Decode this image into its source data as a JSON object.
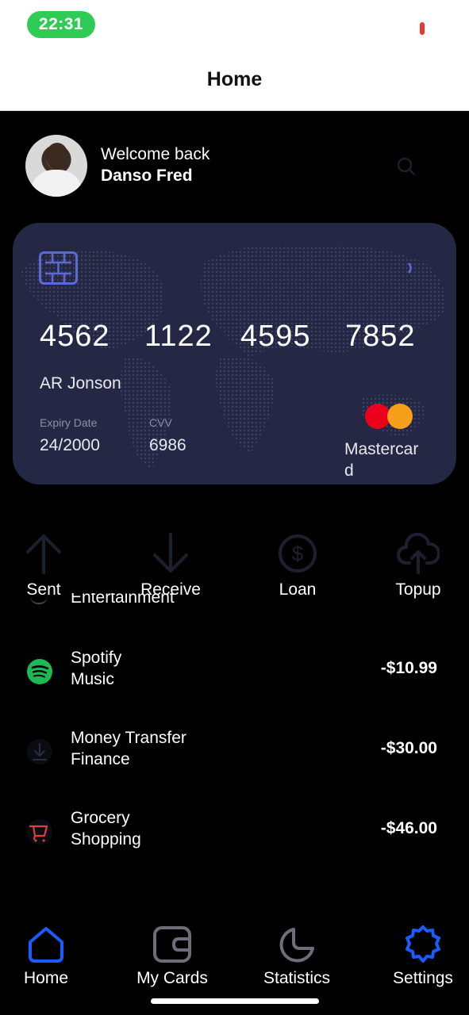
{
  "status": {
    "time": "22:31"
  },
  "nav": {
    "title": "Home"
  },
  "header": {
    "welcome": "Welcome back",
    "name": "Danso Fred"
  },
  "card": {
    "number_groups": [
      "4562",
      "1122",
      "4595",
      "7852"
    ],
    "holder": "AR Jonson",
    "expiry_label": "Expiry Date",
    "expiry": "24/2000",
    "cvv_label": "CVV",
    "cvv": "6986",
    "brand": "Mastercard",
    "colors": {
      "card_bg": "#252845",
      "mc_red": "#eb001b",
      "mc_yellow": "#f79e1b"
    }
  },
  "actions": [
    {
      "label": "Sent",
      "icon": "arrow-up-icon"
    },
    {
      "label": "Receive",
      "icon": "arrow-down-icon"
    },
    {
      "label": "Loan",
      "icon": "dollar-circle-icon"
    },
    {
      "label": "Topup",
      "icon": "cloud-upload-icon"
    }
  ],
  "partial_category": "Entertainment",
  "transactions": [
    {
      "title": "Spotify",
      "category": "Music",
      "amount": "-$10.99",
      "icon": "spotify-icon"
    },
    {
      "title": "Money Transfer",
      "category": "Finance",
      "amount": "-$30.00",
      "icon": "download-icon"
    },
    {
      "title": "Grocery",
      "category": "Shopping",
      "amount": "-$46.00",
      "icon": "cart-icon"
    }
  ],
  "tabs": [
    {
      "label": "Home",
      "icon": "home-icon",
      "active": true
    },
    {
      "label": "My Cards",
      "icon": "wallet-icon",
      "active": false
    },
    {
      "label": "Statistics",
      "icon": "pie-chart-icon",
      "active": false
    },
    {
      "label": "Settings",
      "icon": "gear-icon",
      "active": true
    }
  ],
  "colors": {
    "status_green": "#2ecc54",
    "active_tab": "#1a5cff",
    "spotify": "#1db954"
  }
}
